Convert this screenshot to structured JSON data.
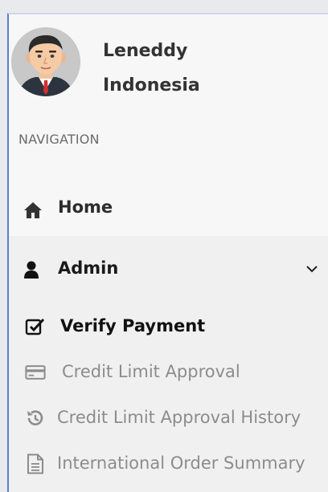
{
  "profile": {
    "name_line1": "Leneddy",
    "name_line2": "Indonesia"
  },
  "navigation": {
    "header": "NAVIGATION",
    "home": {
      "label": "Home",
      "icon": "home-icon"
    },
    "admin": {
      "label": "Admin",
      "icon": "user-icon",
      "expanded": true,
      "items": [
        {
          "label": "Verify Payment",
          "icon": "checkbox-checked-icon",
          "active": true
        },
        {
          "label": "Credit Limit Approval",
          "icon": "credit-card-icon",
          "active": false
        },
        {
          "label": "Credit Limit Approval History",
          "icon": "history-icon",
          "active": false
        },
        {
          "label": "International Order Summary",
          "icon": "document-icon",
          "active": false
        }
      ]
    }
  },
  "colors": {
    "sidebar_bg": "#f7f7f8",
    "submenu_bg": "#f0f0f1",
    "accent_border": "#5a7ec9",
    "muted_text": "#8c8c8c"
  }
}
